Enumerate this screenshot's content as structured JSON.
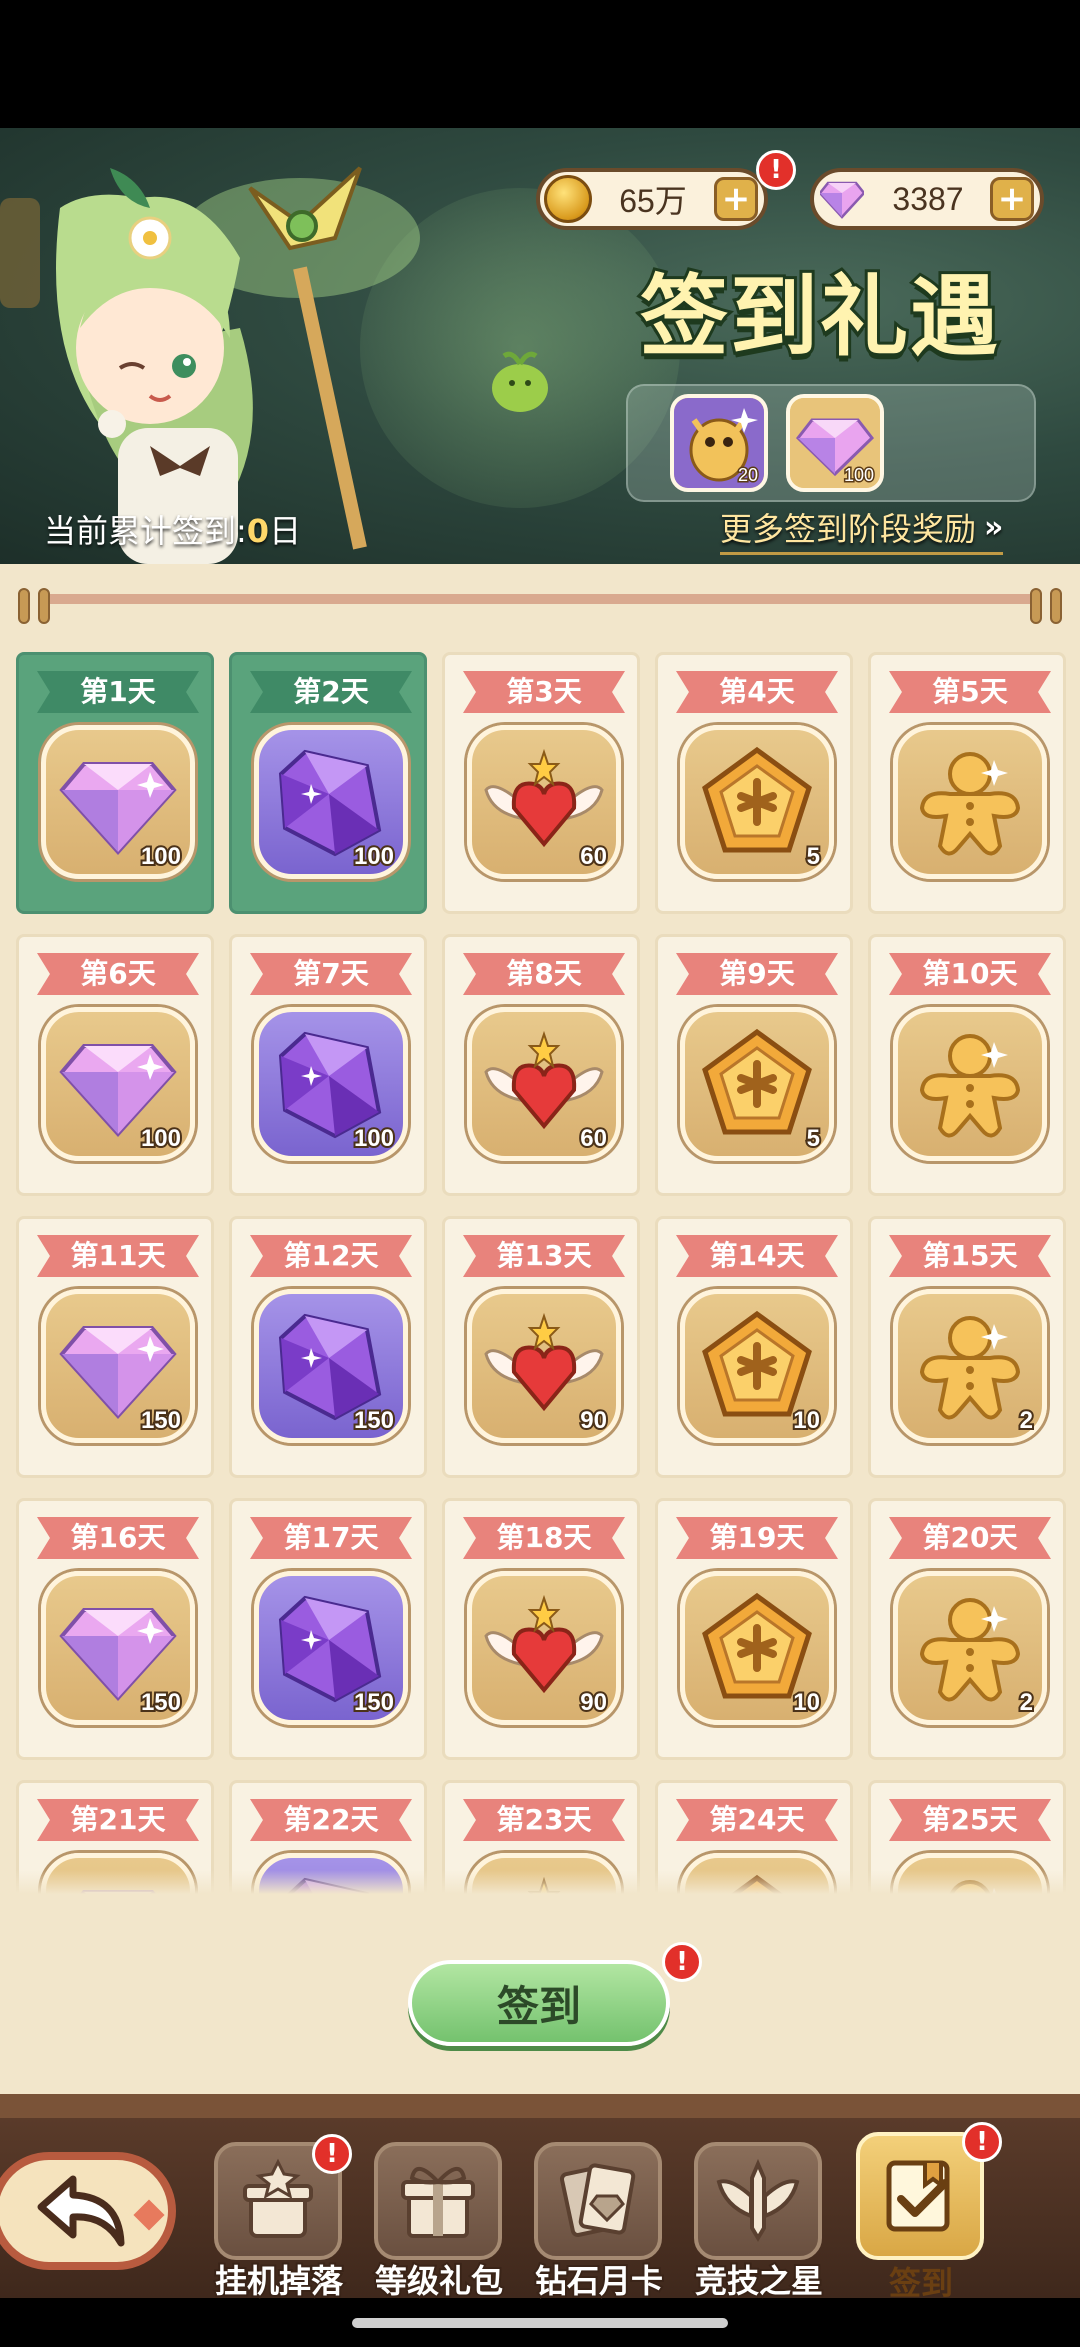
{
  "currency": {
    "gold": {
      "icon": "gold-coin-icon",
      "value": "65万"
    },
    "gems": {
      "icon": "diamond-icon",
      "value": "3387"
    },
    "plus": "+"
  },
  "banner": {
    "title": "签到礼遇",
    "cumulative_prefix": "当前累计签到:",
    "cumulative_days": "0",
    "cumulative_suffix": "日",
    "more_rewards": "更多签到阶段奖励",
    "more_rewards_arrows": "»",
    "stage_rewards": [
      {
        "icon": "dragon-pet-icon",
        "amount": "20"
      },
      {
        "icon": "diamond-icon",
        "amount": "100"
      }
    ]
  },
  "days": [
    {
      "label": "第1天",
      "reward": "diamond",
      "qty": "100",
      "claimed": true
    },
    {
      "label": "第2天",
      "reward": "purple-crystal",
      "qty": "100",
      "claimed": true
    },
    {
      "label": "第3天",
      "reward": "winged-heart",
      "qty": "60",
      "claimed": false
    },
    {
      "label": "第4天",
      "reward": "pentagon-medal",
      "qty": "5",
      "claimed": false
    },
    {
      "label": "第5天",
      "reward": "gingerbread",
      "qty": "",
      "claimed": false
    },
    {
      "label": "第6天",
      "reward": "diamond",
      "qty": "100",
      "claimed": false
    },
    {
      "label": "第7天",
      "reward": "purple-crystal",
      "qty": "100",
      "claimed": false
    },
    {
      "label": "第8天",
      "reward": "winged-heart",
      "qty": "60",
      "claimed": false
    },
    {
      "label": "第9天",
      "reward": "pentagon-medal",
      "qty": "5",
      "claimed": false
    },
    {
      "label": "第10天",
      "reward": "gingerbread",
      "qty": "",
      "claimed": false
    },
    {
      "label": "第11天",
      "reward": "diamond",
      "qty": "150",
      "claimed": false
    },
    {
      "label": "第12天",
      "reward": "purple-crystal",
      "qty": "150",
      "claimed": false
    },
    {
      "label": "第13天",
      "reward": "winged-heart",
      "qty": "90",
      "claimed": false
    },
    {
      "label": "第14天",
      "reward": "pentagon-medal",
      "qty": "10",
      "claimed": false
    },
    {
      "label": "第15天",
      "reward": "gingerbread",
      "qty": "2",
      "claimed": false
    },
    {
      "label": "第16天",
      "reward": "diamond",
      "qty": "150",
      "claimed": false
    },
    {
      "label": "第17天",
      "reward": "purple-crystal",
      "qty": "150",
      "claimed": false
    },
    {
      "label": "第18天",
      "reward": "winged-heart",
      "qty": "90",
      "claimed": false
    },
    {
      "label": "第19天",
      "reward": "pentagon-medal",
      "qty": "10",
      "claimed": false
    },
    {
      "label": "第20天",
      "reward": "gingerbread",
      "qty": "2",
      "claimed": false
    },
    {
      "label": "第21天",
      "reward": "diamond",
      "qty": "",
      "claimed": false
    },
    {
      "label": "第22天",
      "reward": "purple-crystal",
      "qty": "",
      "claimed": false
    },
    {
      "label": "第23天",
      "reward": "winged-heart",
      "qty": "",
      "claimed": false
    },
    {
      "label": "第24天",
      "reward": "pentagon-medal",
      "qty": "",
      "claimed": false
    },
    {
      "label": "第25天",
      "reward": "gingerbread",
      "qty": "",
      "claimed": false
    }
  ],
  "signin_button": "签到",
  "alert_mark": "!",
  "nav": {
    "back": "back-arrow-icon",
    "items": [
      {
        "label": "挂机掉落",
        "icon": "idle-drop-icon",
        "alert": true,
        "active": false
      },
      {
        "label": "等级礼包",
        "icon": "gift-box-icon",
        "alert": false,
        "active": false
      },
      {
        "label": "钻石月卡",
        "icon": "card-diamond-icon",
        "alert": false,
        "active": false
      },
      {
        "label": "竞技之星",
        "icon": "sword-wings-icon",
        "alert": false,
        "active": false
      },
      {
        "label": "签到",
        "icon": "checkin-icon",
        "alert": true,
        "active": true
      }
    ]
  },
  "colors": {
    "claimed_green": "#5aa37c",
    "ribbon_pink": "#e8837c",
    "parchment": "#f2e6cb",
    "button_green": "#74c26e"
  }
}
